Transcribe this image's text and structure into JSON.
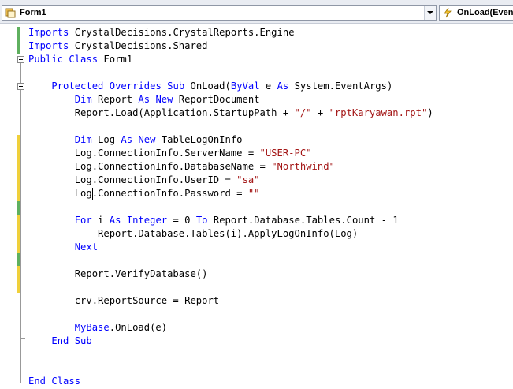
{
  "navbar": {
    "class_combo": "Form1",
    "method_combo": "OnLoad(EventArgs)"
  },
  "code": {
    "l1": {
      "a": "Imports",
      "b": " CrystalDecisions.CrystalReports.Engine"
    },
    "l2": {
      "a": "Imports",
      "b": " CrystalDecisions.Shared"
    },
    "l3": {
      "a": "Public",
      "b": " ",
      "c": "Class",
      "d": " Form1"
    },
    "l5": {
      "a": "    ",
      "b": "Protected",
      "c": " ",
      "d": "Overrides",
      "e": " ",
      "f": "Sub",
      "g": " OnLoad(",
      "h": "ByVal",
      "i": " e ",
      "j": "As",
      "k": " System.EventArgs)"
    },
    "l6": {
      "a": "        ",
      "b": "Dim",
      "c": " Report ",
      "d": "As",
      "e": " ",
      "f": "New",
      "g": " ReportDocument"
    },
    "l7": {
      "a": "        Report.Load(Application.StartupPath + ",
      "b": "\"/\"",
      "c": " + ",
      "d": "\"rptKaryawan.rpt\"",
      "e": ")"
    },
    "l9": {
      "a": "        ",
      "b": "Dim",
      "c": " Log ",
      "d": "As",
      "e": " ",
      "f": "New",
      "g": " TableLogOnInfo"
    },
    "l10": {
      "a": "        Log.ConnectionInfo.ServerName = ",
      "b": "\"USER-PC\""
    },
    "l11": {
      "a": "        Log.ConnectionInfo.DatabaseName = ",
      "b": "\"Northwind\""
    },
    "l12": {
      "a": "        Log.ConnectionInfo.UserID = ",
      "b": "\"sa\""
    },
    "l13": {
      "a": "        Log.ConnectionInfo.Password = ",
      "b": "\"\""
    },
    "l15": {
      "a": "        ",
      "b": "For",
      "c": " i ",
      "d": "As",
      "e": " ",
      "f": "Integer",
      "g": " = 0 ",
      "h": "To",
      "i": " Report.Database.Tables.Count - 1"
    },
    "l16": {
      "a": "            Report.Database.Tables(i).ApplyLogOnInfo(Log)"
    },
    "l17": {
      "a": "        ",
      "b": "Next"
    },
    "l19": {
      "a": "        Report.VerifyDatabase()"
    },
    "l21": {
      "a": "        crv.ReportSource = Report"
    },
    "l23": {
      "a": "        ",
      "b": "MyBase",
      "c": ".OnLoad(e)"
    },
    "l24": {
      "a": "    ",
      "b": "End",
      "c": " ",
      "d": "Sub"
    },
    "l27": {
      "a": "End",
      "b": " ",
      "c": "Class"
    }
  }
}
